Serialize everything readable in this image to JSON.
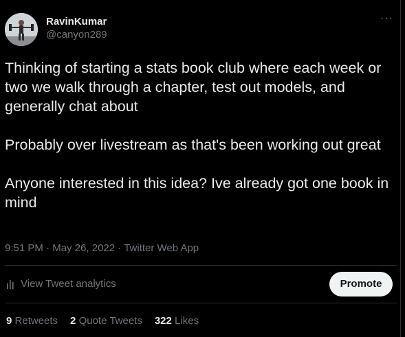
{
  "tweet": {
    "display_name": "RavinKumar",
    "handle": "@canyon289",
    "more_icon": "more-horizontal-icon",
    "paragraphs": [
      "Thinking of starting a stats book club where each week or two we walk through a chapter, test out models, and generally chat about",
      "Probably over livestream as that's been working out great",
      "Anyone interested in this idea? Ive already got one book in mind"
    ],
    "time": "9:51 PM",
    "date": "May 26, 2022",
    "source": "Twitter Web App",
    "separator": " · "
  },
  "analytics": {
    "icon": "bar-chart-icon",
    "label": "View Tweet analytics",
    "promote_label": "Promote"
  },
  "stats": {
    "retweets_count": "9",
    "retweets_label": "Retweets",
    "quote_count": "2",
    "quote_label": "Quote Tweets",
    "likes_count": "322",
    "likes_label": "Likes"
  },
  "colors": {
    "background": "#000000",
    "text_primary": "#e7e9ea",
    "text_secondary": "#71767b",
    "border": "#2f3336",
    "button_bg": "#eff3f4"
  }
}
